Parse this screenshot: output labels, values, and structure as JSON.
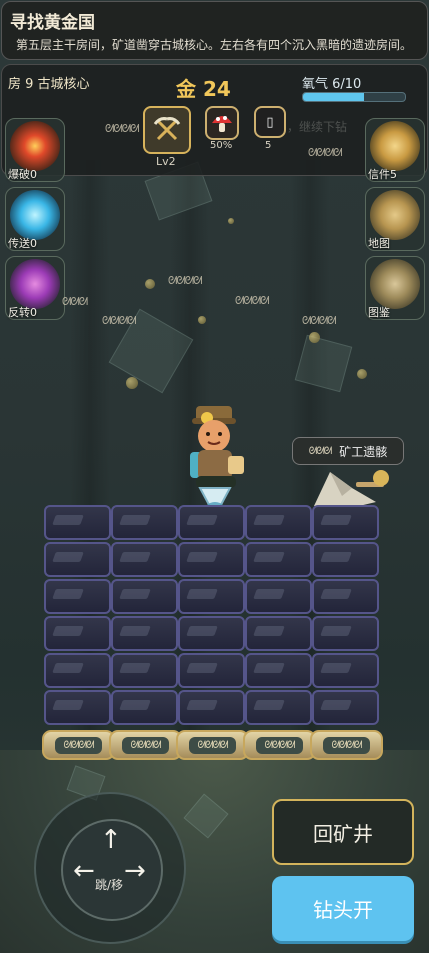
{
  "header": {
    "title": "寻找黄金国",
    "subtitle": "第五层主干房间，矿道凿穿古城核心。左右各有四个沉入黑暗的遗迹房间。"
  },
  "status": {
    "room": "房 9 古城核心",
    "gold": "金 24",
    "oxygen_label": "氧气 6/10",
    "oxygen_fraction": 0.6,
    "pickaxe_level": "Lv2",
    "mushroom_value": "50%",
    "letter_value": "5",
    "letter_glyph": "▯",
    "hint_ghost": "司，继续下钻"
  },
  "left_tools": [
    {
      "label": "爆破0",
      "icon": "explosion-icon"
    },
    {
      "label": "传送0",
      "icon": "teleport-portal-icon"
    },
    {
      "label": "反转0",
      "icon": "reverse-arrows-icon"
    }
  ],
  "right_tools": [
    {
      "label": "信件5",
      "icon": "scroll-letter-icon"
    },
    {
      "label": "地图",
      "icon": "map-icon"
    },
    {
      "label": "图鉴",
      "icon": "book-icon"
    }
  ],
  "glyphs": {
    "runes_a": "ᘛᘛᘛ",
    "runes_b": "ᘛᘛᘛᘛ",
    "npc_runes": "ᘛᘛᘛ",
    "plate_runes": "ᘛᘛᘛᘛ"
  },
  "npc": {
    "tag_label": "矿工遗骸"
  },
  "controls": {
    "joystick_label": "跳/移",
    "up_arrow": "↑",
    "left_arrow": "←",
    "right_arrow": "→",
    "back_button": "回矿井",
    "drill_button": "钻头开"
  },
  "colors": {
    "gold": "#f1c75a",
    "oxygen": "#5fc6ee",
    "drill_button": "#5ec3f0",
    "block_border": "#55558a"
  }
}
